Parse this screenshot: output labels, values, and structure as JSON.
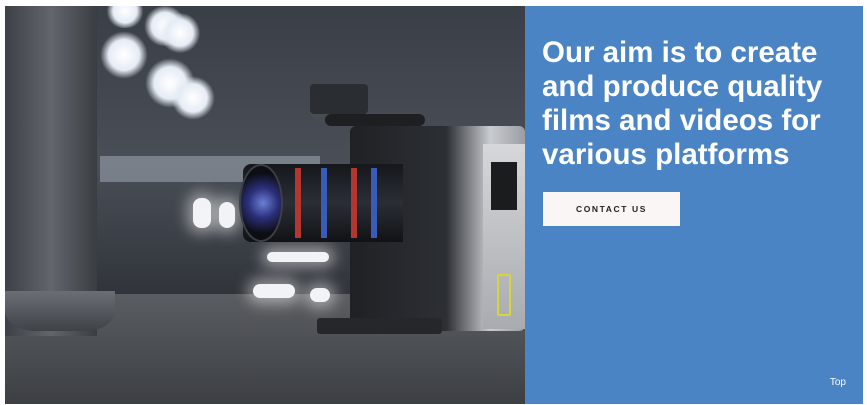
{
  "hero": {
    "image_alt": "cinema-camera-photo",
    "headline": "Our aim is to create and produce quality films and videos for various platforms",
    "cta_label": "CONTACT US",
    "top_link": "Top"
  },
  "colors": {
    "panel_bg": "#4a84c4",
    "cta_bg": "#faf6f5",
    "text_light": "#ffffff"
  }
}
